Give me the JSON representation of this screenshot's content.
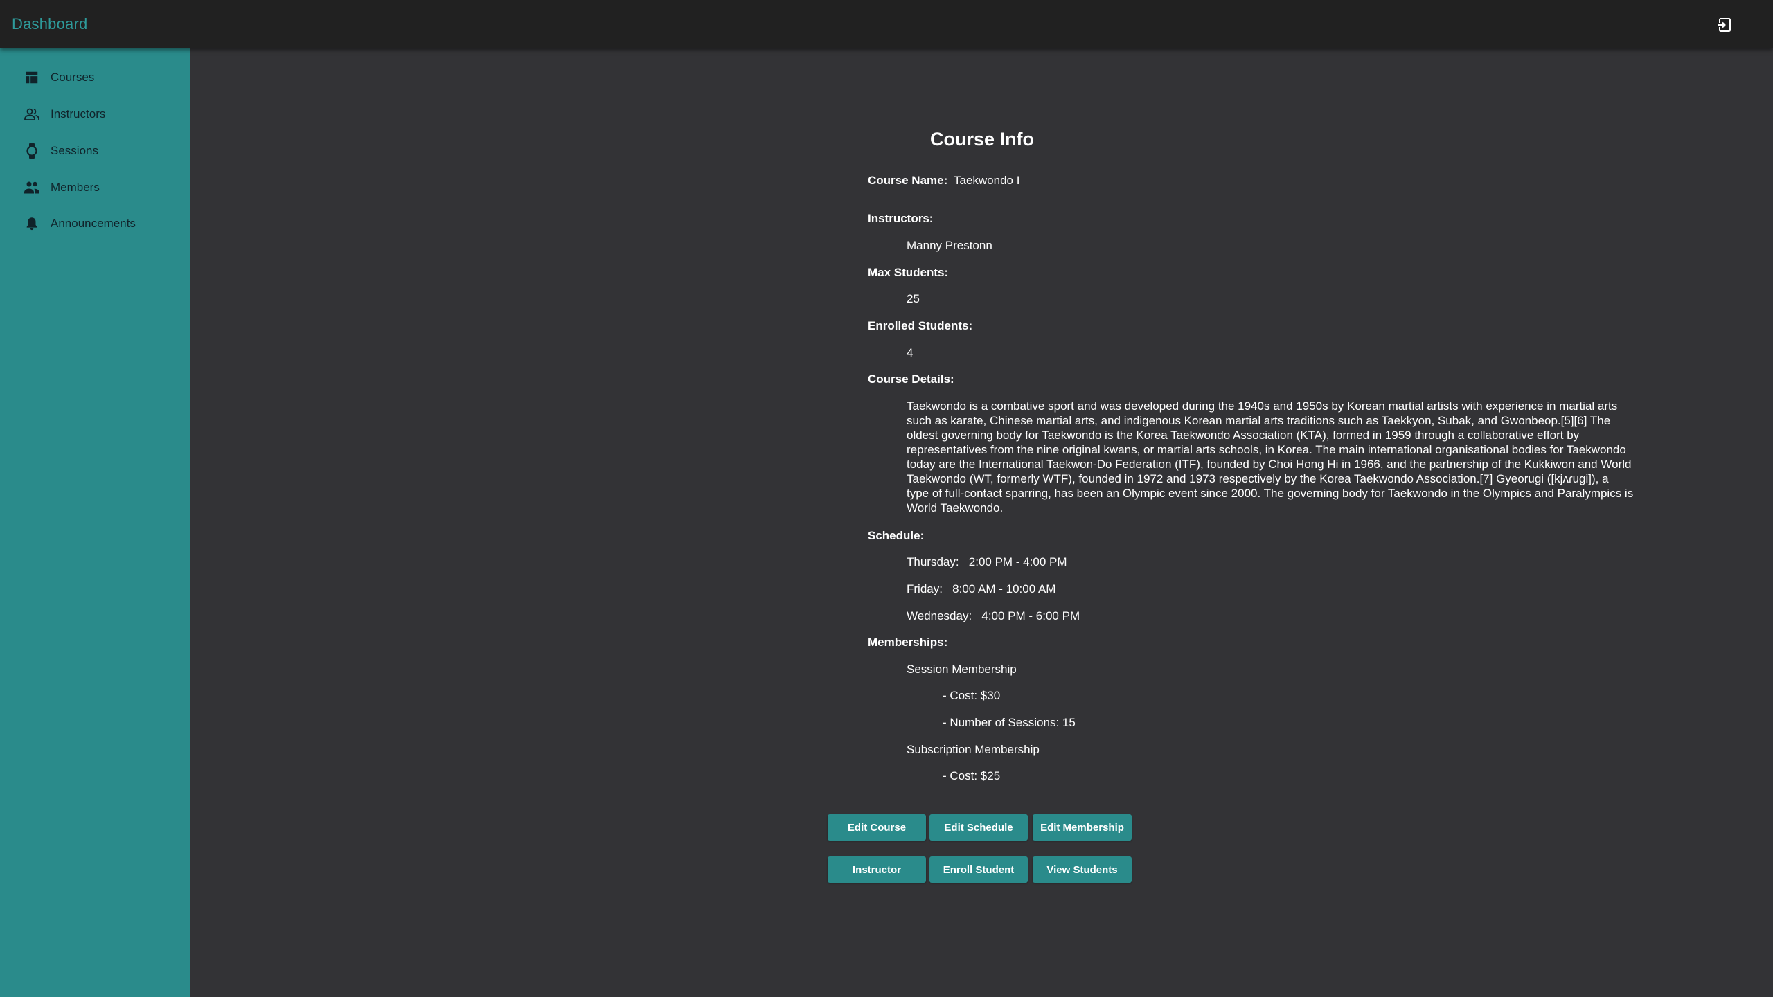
{
  "header": {
    "title": "Dashboard",
    "logout_icon": "logout-icon"
  },
  "sidebar": {
    "items": [
      {
        "label": "Courses",
        "icon": "table-icon"
      },
      {
        "label": "Instructors",
        "icon": "people-outline-icon"
      },
      {
        "label": "Sessions",
        "icon": "watch-icon"
      },
      {
        "label": "Members",
        "icon": "people-icon"
      },
      {
        "label": "Announcements",
        "icon": "bell-icon"
      }
    ]
  },
  "page": {
    "title": "Course Info"
  },
  "course": {
    "name_label": "Course Name:",
    "name": "Taekwondo I",
    "instructors_label": "Instructors:",
    "instructors": [
      "Manny Prestonn"
    ],
    "max_label": "Max Students:",
    "max_students": "25",
    "enrolled_label": "Enrolled Students:",
    "enrolled_students": "4",
    "details_label": "Course Details:",
    "details": "Taekwondo is a combative sport and was developed during the 1940s and 1950s by Korean martial artists with experience in martial arts such as karate, Chinese martial arts, and indigenous Korean martial arts traditions such as Taekkyon, Subak, and Gwonbeop.[5][6] The oldest governing body for Taekwondo is the Korea Taekwondo Association (KTA), formed in 1959 through a collaborative effort by representatives from the nine original kwans, or martial arts schools, in Korea. The main international organisational bodies for Taekwondo today are the International Taekwon-Do Federation (ITF), founded by Choi Hong Hi in 1966, and the partnership of the Kukkiwon and World Taekwondo (WT, formerly WTF), founded in 1972 and 1973 respectively by the Korea Taekwondo Association.[7] Gyeorugi ([kjʌɾugi]), a type of full-contact sparring, has been an Olympic event since 2000. The governing body for Taekwondo in the Olympics and Paralympics is World Taekwondo.",
    "schedule_label": "Schedule:",
    "schedule": [
      {
        "day": "Thursday:",
        "time": "2:00 PM - 4:00 PM"
      },
      {
        "day": "Friday:",
        "time": "8:00 AM - 10:00 AM"
      },
      {
        "day": "Wednesday:",
        "time": "4:00 PM - 6:00 PM"
      }
    ],
    "memberships_label": "Memberships:",
    "memberships": [
      {
        "name": "Session Membership",
        "cost": "- Cost: $30",
        "sessions": "- Number of Sessions: 15"
      },
      {
        "name": "Subscription Membership",
        "cost": "- Cost: $25"
      }
    ]
  },
  "actions": {
    "edit_course": "Edit Course",
    "edit_schedule": "Edit Schedule",
    "edit_membership": "Edit Membership",
    "instructor": "Instructor",
    "enroll_student": "Enroll Student",
    "view_students": "View Students"
  },
  "colors": {
    "accent": "#2a8b8b",
    "topbar": "#212121",
    "background": "#333336"
  }
}
